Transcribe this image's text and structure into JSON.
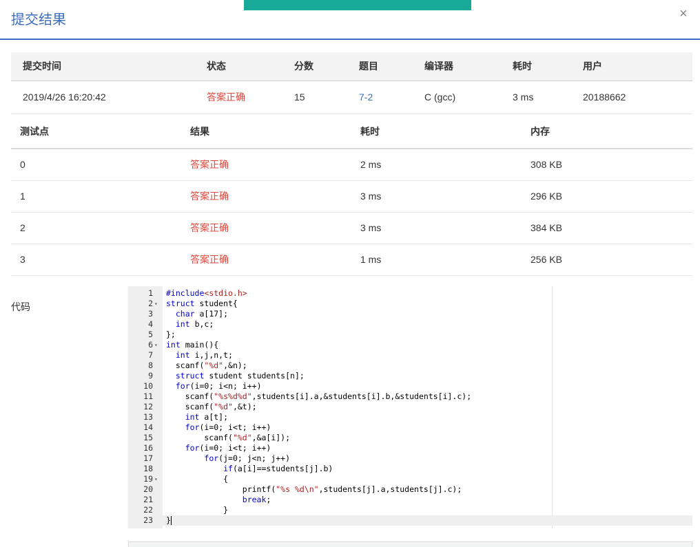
{
  "dialog": {
    "title": "提交结果",
    "close_label": "×"
  },
  "submission": {
    "headers": [
      "提交时间",
      "状态",
      "分数",
      "题目",
      "编译器",
      "耗时",
      "用户"
    ],
    "row": {
      "time": "2019/4/26 16:20:42",
      "status": "答案正确",
      "score": "15",
      "problem": "7-2",
      "compiler": "C (gcc)",
      "elapsed": "3 ms",
      "user": "20188662"
    }
  },
  "tests": {
    "headers": [
      "测试点",
      "结果",
      "耗时",
      "内存"
    ],
    "rows": [
      {
        "id": "0",
        "result": "答案正确",
        "time": "2 ms",
        "memory": "308 KB"
      },
      {
        "id": "1",
        "result": "答案正确",
        "time": "3 ms",
        "memory": "296 KB"
      },
      {
        "id": "2",
        "result": "答案正确",
        "time": "3 ms",
        "memory": "384 KB"
      },
      {
        "id": "3",
        "result": "答案正确",
        "time": "1 ms",
        "memory": "256 KB"
      }
    ]
  },
  "code": {
    "label": "代码",
    "lines": [
      "#include<stdio.h>",
      "struct student{",
      "  char a[17];",
      "  int b,c;",
      "};",
      "int main(){",
      "  int i,j,n,t;",
      "  scanf(\"%d\",&n);",
      "  struct student students[n];",
      "  for(i=0; i<n; i++)",
      "    scanf(\"%s%d%d\",students[i].a,&students[i].b,&students[i].c);",
      "    scanf(\"%d\",&t);",
      "    int a[t];",
      "    for(i=0; i<t; i++)",
      "        scanf(\"%d\",&a[i]);",
      "    for(i=0; i<t; i++)",
      "        for(j=0; j<n; j++)",
      "            if(a[i]==students[j].b)",
      "            {",
      "                printf(\"%s %d\\n\",students[j].a,students[j].c);",
      "                break;",
      "            }",
      "}"
    ],
    "fold_lines": [
      2,
      6,
      19
    ],
    "fold_marker": "▾",
    "active_line": 23
  },
  "colors": {
    "accent": "#3d6dbf",
    "success_text": "#e0483e",
    "top_bar": "#18a999"
  }
}
